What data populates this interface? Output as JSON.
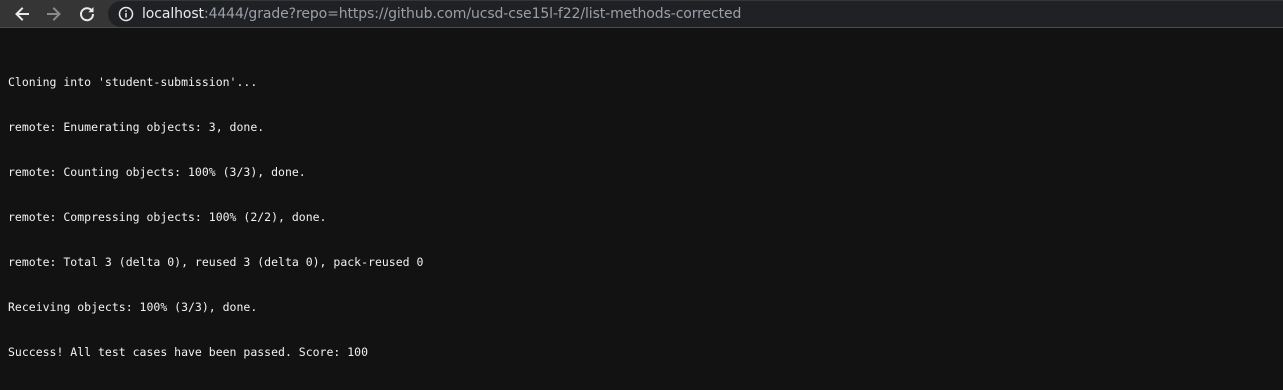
{
  "browser": {
    "back_icon": "arrow-left-icon",
    "forward_icon": "arrow-right-icon",
    "reload_icon": "reload-icon",
    "info_icon": "info-circle-icon",
    "url_host": "localhost",
    "url_rest": ":4444/grade?repo=https://github.com/ucsd-cse15l-f22/list-methods-corrected"
  },
  "output": {
    "lines": [
      "Cloning into 'student-submission'...",
      "remote: Enumerating objects: 3, done.",
      "remote: Counting objects: 100% (3/3), done.",
      "remote: Compressing objects: 100% (2/2), done.",
      "remote: Total 3 (delta 0), reused 3 (delta 0), pack-reused 0",
      "Receiving objects: 100% (3/3), done.",
      "Success! All test cases have been passed. Score: 100"
    ]
  },
  "colors": {
    "toolbar_bg": "#353535",
    "omnibox_bg": "#202124",
    "page_bg": "#121212",
    "text": "#f2f2f2"
  }
}
